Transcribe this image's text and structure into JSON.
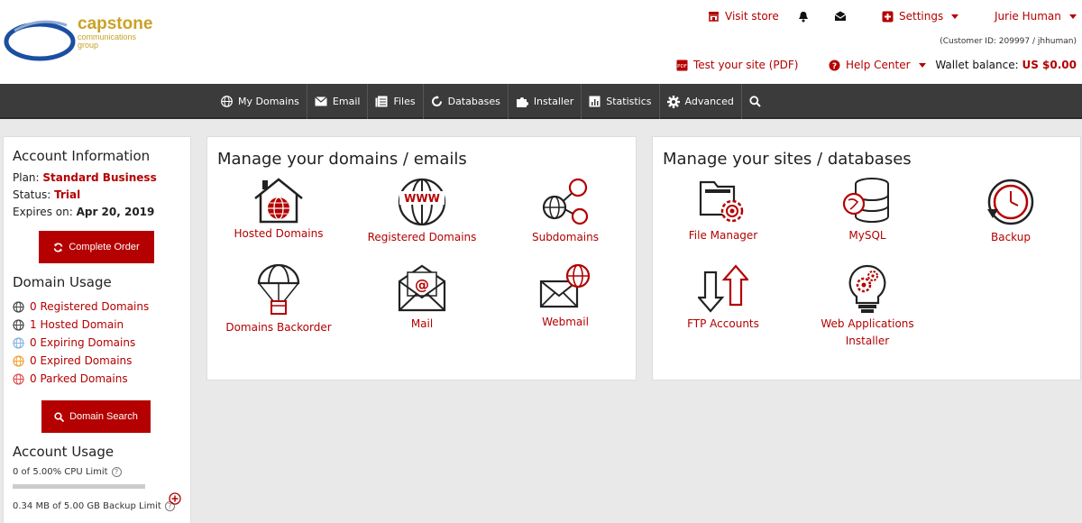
{
  "header": {
    "logo_name": "capstone",
    "logo_sub_1": "communications",
    "logo_sub_2": "group",
    "visit_store": "Visit store",
    "settings": "Settings",
    "user": "Jurie Human",
    "customer_id": "(Customer ID: 209997 / jhhuman)",
    "test_site": "Test your site (PDF)",
    "help_center": "Help Center",
    "wallet_label": "Wallet balance:",
    "wallet_value": "US $0.00"
  },
  "nav": [
    {
      "label": "My Domains",
      "icon": "globe-icon"
    },
    {
      "label": "Email",
      "icon": "envelope-icon"
    },
    {
      "label": "Files",
      "icon": "files-icon"
    },
    {
      "label": "Databases",
      "icon": "refresh-icon"
    },
    {
      "label": "Installer",
      "icon": "puzzle-icon"
    },
    {
      "label": "Statistics",
      "icon": "bar-chart-icon"
    },
    {
      "label": "Advanced",
      "icon": "gear-icon"
    }
  ],
  "account": {
    "title": "Account Information",
    "plan_label": "Plan:",
    "plan_value": "Standard Business",
    "status_label": "Status:",
    "status_value": "Trial",
    "expires_label": "Expires on:",
    "expires_value": "Apr 20, 2019",
    "complete_order": "Complete Order"
  },
  "domain_usage": {
    "title": "Domain Usage",
    "items": [
      {
        "label": "0 Registered Domains",
        "color": "#444444"
      },
      {
        "label": "1 Hosted Domain",
        "color": "#444444"
      },
      {
        "label": "0 Expiring Domains",
        "color": "#7fb2e0"
      },
      {
        "label": "0 Expired Domains",
        "color": "#f0a030"
      },
      {
        "label": "0 Parked Domains",
        "color": "#e05050"
      }
    ],
    "search_button": "Domain Search"
  },
  "account_usage": {
    "title": "Account Usage",
    "cpu": "0 of 5.00% CPU Limit",
    "backup": "0.34 MB of 5.00 GB Backup Limit"
  },
  "domains_panel": {
    "title": "Manage your domains / emails",
    "tiles": [
      "Hosted Domains",
      "Registered Domains",
      "Subdomains",
      "Domains Backorder",
      "Mail",
      "Webmail"
    ]
  },
  "sites_panel": {
    "title": "Manage your sites / databases",
    "tiles": [
      "File Manager",
      "MySQL",
      "Backup",
      "FTP Accounts",
      "Web Applications Installer"
    ]
  },
  "colors": {
    "accent": "#b40000",
    "nav_bg": "#3b3b3b",
    "logo_gold": "#c9a227",
    "logo_blue": "#1b4fa0"
  }
}
